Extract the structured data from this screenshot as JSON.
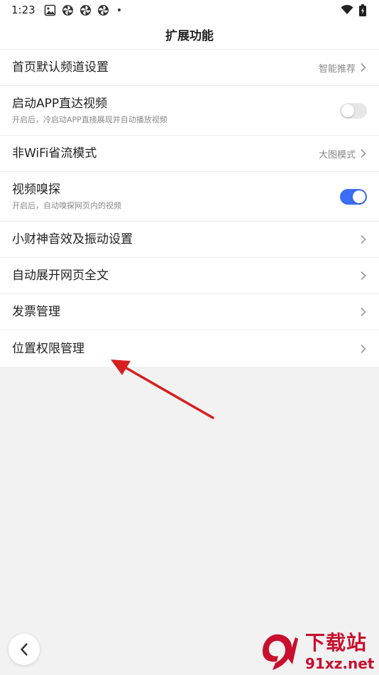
{
  "status_bar": {
    "time": "1:23"
  },
  "header": {
    "title": "扩展功能"
  },
  "settings": [
    {
      "label": "首页默认频道设置",
      "value": "智能推荐",
      "type": "link"
    },
    {
      "label": "启动APP直达视频",
      "sub": "开启后，冷启动APP直接展现并自动播放视频",
      "type": "toggle",
      "enabled": false
    },
    {
      "label": "非WiFi省流模式",
      "value": "大图模式",
      "type": "link"
    },
    {
      "label": "视频嗅探",
      "sub": "开启后，自动嗅探网页内的视频",
      "type": "toggle",
      "enabled": true
    },
    {
      "label": "小财神音效及振动设置",
      "type": "link"
    },
    {
      "label": "自动展开网页全文",
      "type": "link"
    },
    {
      "label": "发票管理",
      "type": "link"
    },
    {
      "label": "位置权限管理",
      "type": "link"
    }
  ],
  "watermark": {
    "top": "下载站",
    "bottom": "91xz.net"
  },
  "colors": {
    "accent": "#3a6cf6",
    "annotation_arrow": "#d62020",
    "watermark": "#c8102e"
  },
  "icons": [
    "photo-icon",
    "pinwheel-icon",
    "wifi-icon",
    "battery-icon",
    "chevron-right-icon",
    "back-arrow-icon",
    "red-annotation-arrow"
  ]
}
